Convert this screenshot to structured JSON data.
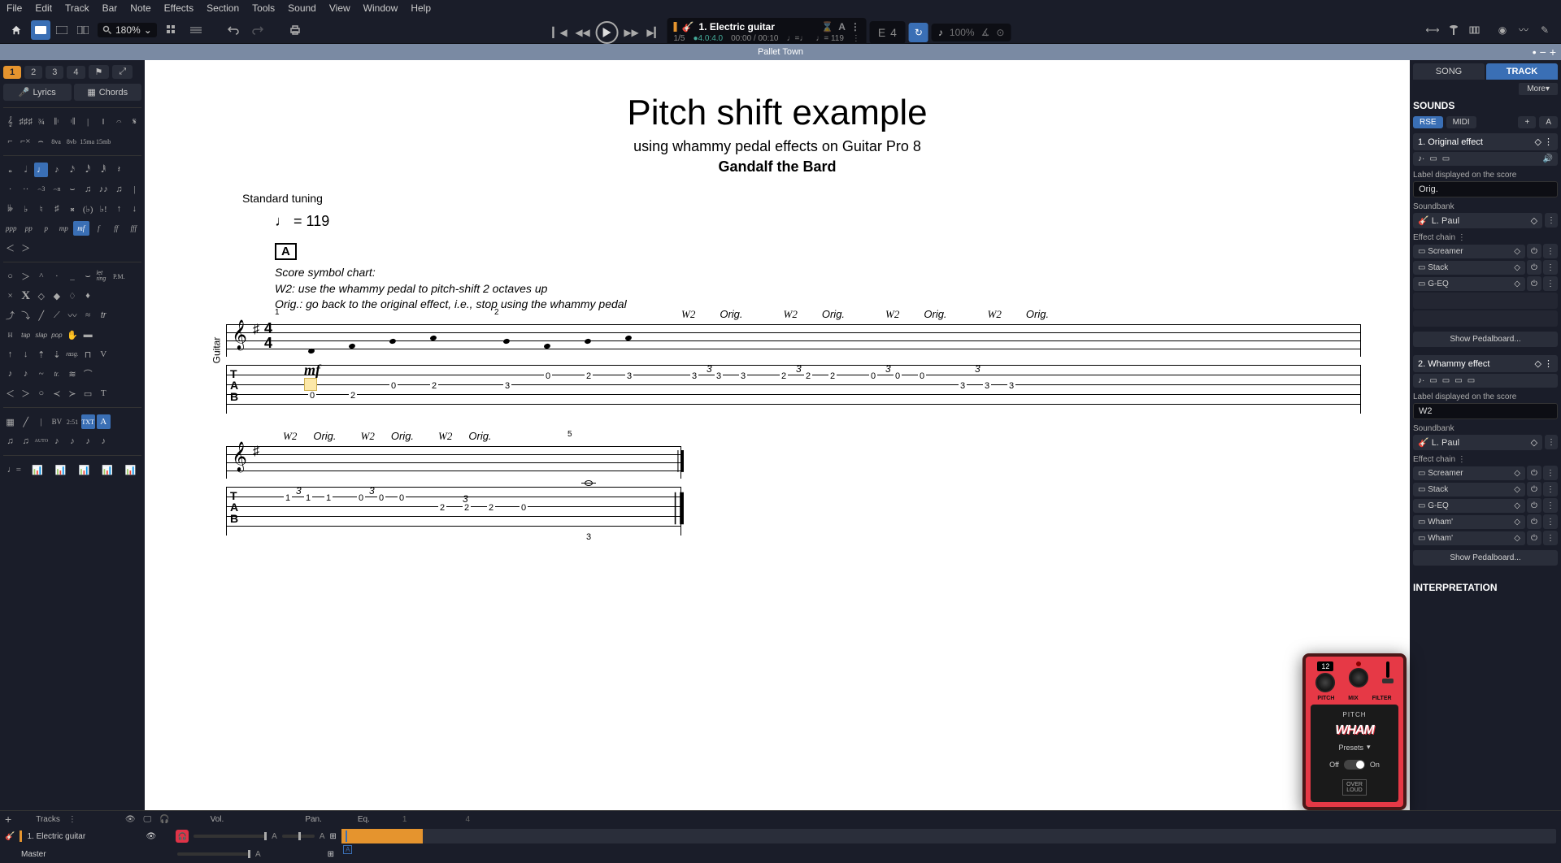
{
  "menu": [
    "File",
    "Edit",
    "Track",
    "Bar",
    "Note",
    "Effects",
    "Section",
    "Tools",
    "Sound",
    "View",
    "Window",
    "Help"
  ],
  "toolbar": {
    "zoom": "180%"
  },
  "transport": {
    "track_name": "1. Electric guitar",
    "bar_pos": "1/5",
    "time_sig": "4.0:4.0",
    "time": "00:00 / 00:10",
    "tempo_note": "♩=♩",
    "tempo_bpm": "♩= 119",
    "note_display": "E 4",
    "speed": "100%"
  },
  "title": "Pallet Town",
  "palette": {
    "tracks": [
      "1",
      "2",
      "3",
      "4"
    ],
    "lyrics_label": "Lyrics",
    "chords_label": "Chords",
    "dynamics": [
      "ppp",
      "pp",
      "p",
      "mp",
      "mf",
      "f",
      "ff",
      "fff"
    ],
    "bv_time": "2:51"
  },
  "score": {
    "title": "Pitch shift example",
    "subtitle": "using whammy pedal effects on Guitar Pro 8",
    "artist": "Gandalf the Bard",
    "tuning": "Standard tuning",
    "tempo": "♩ = 119",
    "section": "A",
    "notes_header": "Score symbol chart:",
    "notes_line1": "W2: use the whammy pedal to pitch-shift 2 octaves up",
    "notes_line2": "Orig.: go back to the original effect, i.e., stop using the whammy pedal",
    "instrument": "Guitar",
    "mf": "mf",
    "effects_line1": [
      "W2",
      "Orig.",
      "W2",
      "Orig.",
      "W2",
      "Orig.",
      "W2",
      "Orig."
    ],
    "effects_line2": [
      "W2",
      "Orig.",
      "W2",
      "Orig.",
      "W2",
      "Orig."
    ],
    "tab_line1": [
      "0",
      "2",
      "0",
      "2",
      "3",
      "0",
      "2",
      "3",
      "3",
      "3",
      "3",
      "2",
      "2",
      "2",
      "0",
      "0",
      "0",
      "3",
      "3",
      "3"
    ],
    "tab_line2": [
      "1",
      "1",
      "1",
      "0",
      "0",
      "0",
      "2",
      "2",
      "2",
      "0",
      "3"
    ],
    "triplet": "3"
  },
  "right": {
    "tab_song": "SONG",
    "tab_track": "TRACK",
    "more": "More▾",
    "sounds_title": "SOUNDS",
    "mode_rse": "RSE",
    "mode_midi": "MIDI",
    "sounds": [
      {
        "name": "1. Original effect",
        "label_caption": "Label displayed on the score",
        "label_value": "Orig.",
        "soundbank_caption": "Soundbank",
        "soundbank_value": "L. Paul",
        "chain_caption": "Effect chain",
        "effects": [
          "Screamer",
          "Stack",
          "G-EQ"
        ],
        "pedalboard": "Show Pedalboard..."
      },
      {
        "name": "2. Whammy effect",
        "label_caption": "Label displayed on the score",
        "label_value": "W2",
        "soundbank_caption": "Soundbank",
        "soundbank_value": "L. Paul",
        "chain_caption": "Effect chain",
        "effects": [
          "Screamer",
          "Stack",
          "G-EQ",
          "Wham'",
          "Wham'"
        ],
        "pedalboard": "Show Pedalboard..."
      }
    ],
    "interpretation_title": "INTERPRETATION"
  },
  "pedal": {
    "value": "12",
    "label_pitch": "PITCH",
    "label_mix": "MIX",
    "label_filter": "FILTER",
    "section": "PITCH",
    "logo": "WHAM",
    "presets": "Presets",
    "off": "Off",
    "on": "On",
    "brand": "OVER\nLOUD"
  },
  "tracks": {
    "header": "Tracks",
    "col_vol": "Vol.",
    "col_pan": "Pan.",
    "col_eq": "Eq.",
    "rows": [
      {
        "name": "1. Electric guitar"
      },
      {
        "name": "Master"
      }
    ]
  }
}
